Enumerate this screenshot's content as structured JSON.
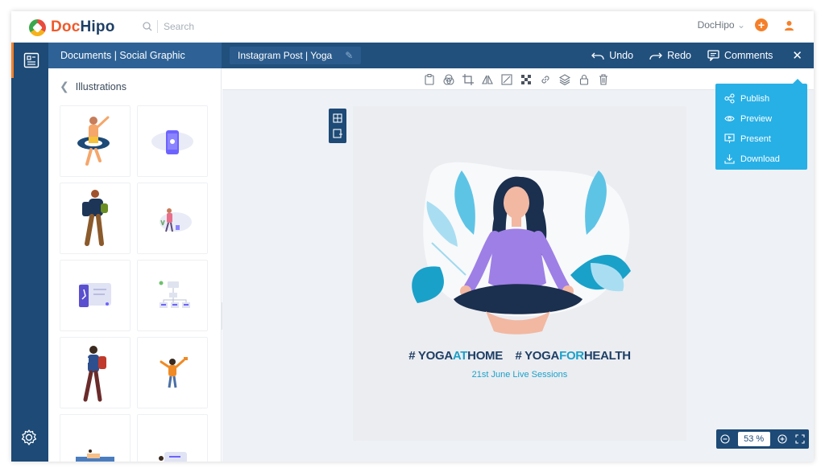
{
  "brand": {
    "part1": "Doc",
    "part2": "Hipo"
  },
  "search": {
    "placeholder": "Search"
  },
  "user": {
    "name": "DocHipo"
  },
  "header": {
    "section_title": "Documents | Social Graphic",
    "document_name": "Instagram Post | Yoga",
    "undo_label": "Undo",
    "redo_label": "Redo",
    "comments_label": "Comments"
  },
  "panel": {
    "title": "Illustrations",
    "tiles": [
      "man-swimming-ring",
      "android-phone",
      "man-backpack",
      "woman-plants",
      "tablet-gesture",
      "flowchart",
      "man-reading",
      "man-cheering",
      "beach-scene",
      "chat-bubble"
    ]
  },
  "toolbar": {
    "tools": [
      "clipboard-icon",
      "color-icon",
      "crop-icon",
      "flip-icon",
      "trim-icon",
      "transparency-icon",
      "link-icon",
      "layers-icon",
      "lock-icon",
      "delete-icon"
    ]
  },
  "canvas": {
    "hashtag1_a": "# YOGA",
    "hashtag1_b": "AT",
    "hashtag1_c": "HOME",
    "hashtag2_a": "# YOGA",
    "hashtag2_b": "FOR",
    "hashtag2_c": "HEALTH",
    "subtitle": "21st June Live Sessions"
  },
  "publish_menu": {
    "items": [
      {
        "label": "Publish",
        "icon": "share-icon"
      },
      {
        "label": "Preview",
        "icon": "eye-icon"
      },
      {
        "label": "Present",
        "icon": "present-icon"
      },
      {
        "label": "Download",
        "icon": "download-icon"
      }
    ]
  },
  "zoom": {
    "value": "53 %"
  },
  "colors": {
    "navy": "#1d4a76",
    "accent": "#f5802a",
    "cyan": "#27b0e6"
  }
}
